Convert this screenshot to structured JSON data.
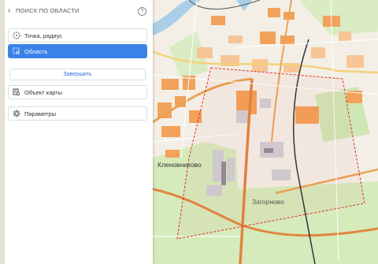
{
  "panel": {
    "title": "ПОИСК ПО ОБЛАСТИ",
    "help_glyph": "?",
    "back_glyph": "‹",
    "items": [
      {
        "label": "Точка, радиус",
        "icon": "dashed-circle-icon",
        "active": false
      },
      {
        "label": "Область",
        "icon": "area-select-icon",
        "active": true
      }
    ],
    "finish_label": "Завершить",
    "object_label": "Объект карты",
    "params_label": "Параметры"
  },
  "map": {
    "places": [
      {
        "label": "Кленовниково"
      },
      {
        "label": "Загорново"
      }
    ],
    "colors": {
      "accent": "#3b82e8",
      "selection": "#d9312c",
      "urban": "#f2994a",
      "green": "#cfe6b5",
      "water": "#a9cfe8",
      "road": "#e9a255"
    }
  }
}
